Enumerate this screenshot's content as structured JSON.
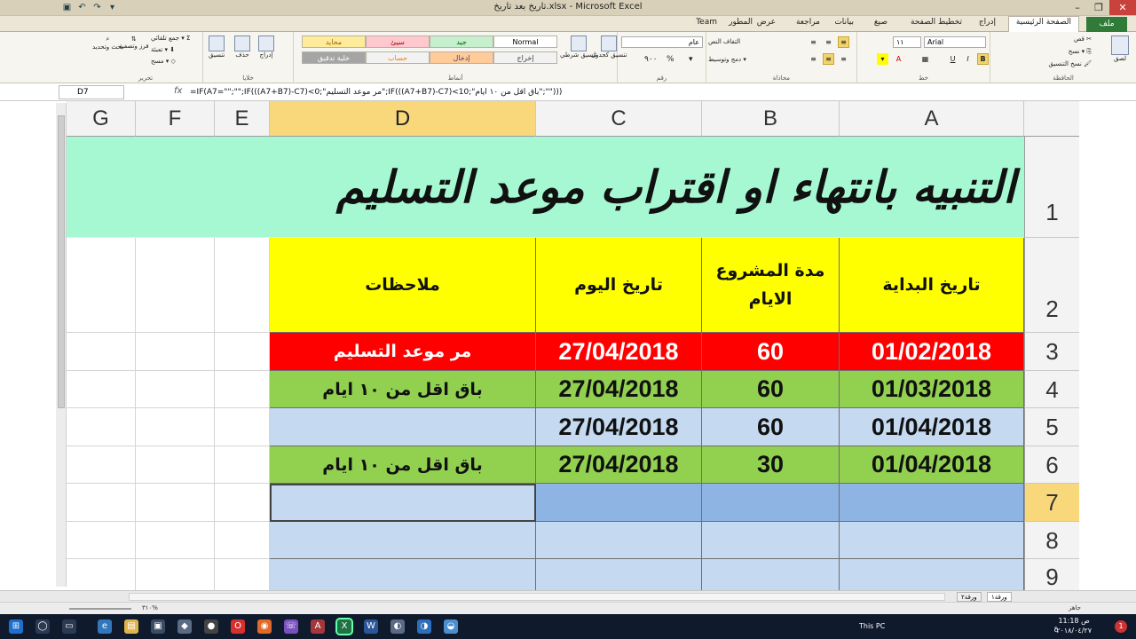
{
  "window": {
    "title": "تاريخ بعد تاريخ.xlsx - Microsoft Excel",
    "minimize": "–",
    "restore": "❐",
    "close": "✕"
  },
  "qat": [
    "▣",
    "↶",
    "↷",
    "▾"
  ],
  "ribbon_tabs": [
    "ملف",
    "الصفحة الرئيسية",
    "إدراج",
    "تخطيط الصفحة",
    "صيغ",
    "بيانات",
    "مراجعة",
    "عرض",
    "المطور",
    "Team"
  ],
  "ribbon": {
    "clipboard": {
      "paste": "لصق",
      "cut": "قص",
      "copy": "نسخ ▾",
      "format_painter": "نسخ التنسيق",
      "label": "الحافظة"
    },
    "font": {
      "name": "Arial",
      "size": "١١",
      "bold": "B",
      "italic": "I",
      "underline": "U",
      "label": "خط"
    },
    "alignment": {
      "wrap": "التفاف النص",
      "merge": "دمج وتوسيط ▾",
      "label": "محاذاة"
    },
    "number": {
      "format": "عام",
      "percent": "%",
      "comma": "٩٠٠",
      "currency": "▾",
      "label": "رقم"
    },
    "styles": {
      "conditional": "تنسيق شرطي",
      "as_table": "تنسيق كجدول",
      "cells": [
        {
          "text": "Normal",
          "bg": "#ffffff",
          "fg": "#000000"
        },
        {
          "text": "جيد",
          "bg": "#c6efce",
          "fg": "#006100"
        },
        {
          "text": "سيئ",
          "bg": "#ffc7ce",
          "fg": "#9c0006"
        },
        {
          "text": "محايد",
          "bg": "#ffeb9c",
          "fg": "#9c6500"
        },
        {
          "text": "إخراج",
          "bg": "#f2f2f2",
          "fg": "#3f3f3f"
        },
        {
          "text": "إدخال",
          "bg": "#ffcc99",
          "fg": "#3f3f76"
        },
        {
          "text": "حساب",
          "bg": "#f2f2f2",
          "fg": "#fa7d00"
        },
        {
          "text": "خلية تدقيق",
          "bg": "#a5a5a5",
          "fg": "#ffffff"
        }
      ],
      "label": "أنماط"
    },
    "cells_group": {
      "insert": "إدراج",
      "delete": "حذف",
      "format": "تنسيق",
      "label": "خلايا"
    },
    "editing": {
      "autosum": "جمع تلقائي ▾",
      "fill": "تعبئة ▾",
      "clear": "مسح ▾",
      "sort": "فرز وتصفية",
      "find": "بحث وتحديد",
      "label": "تحرير"
    }
  },
  "formula_bar": {
    "name_box": "D7",
    "fx": "fx",
    "formula": "=IF(A7=\"\";\"\";IF(((A7+B7)-C7)<0;\"مر موعد التسليم\";IF(((A7+B7)-C7)<10;\"باق اقل من ١٠ ايام\";\"\")))"
  },
  "columns": [
    "G",
    "F",
    "E",
    "D",
    "C",
    "B",
    "A"
  ],
  "selected_column": "D",
  "rows": [
    "1",
    "2",
    "3",
    "4",
    "5",
    "6",
    "7",
    "8",
    "9"
  ],
  "selected_row": "7",
  "sheet": {
    "title": "التنبيه بانتهاء او اقتراب موعد التسليم",
    "headers": {
      "A": "تاريخ البداية",
      "B": "مدة المشروع الايام",
      "C": "تاريخ اليوم",
      "D": "ملاحظات"
    },
    "data": [
      {
        "A": "01/02/2018",
        "B": "60",
        "C": "27/04/2018",
        "D": "مر موعد التسليم",
        "bg": "#ff0000",
        "dbg": "#ff0000",
        "fg": "#ffffff"
      },
      {
        "A": "01/03/2018",
        "B": "60",
        "C": "27/04/2018",
        "D": "باق اقل من ١٠ ايام",
        "bg": "#92d050",
        "dbg": "#92d050",
        "fg": "#111111"
      },
      {
        "A": "01/04/2018",
        "B": "60",
        "C": "27/04/2018",
        "D": "",
        "bg": "#c5d9f1",
        "dbg": "#c5d9f1",
        "fg": "#111111"
      },
      {
        "A": "01/04/2018",
        "B": "30",
        "C": "27/04/2018",
        "D": "باق اقل من ١٠ ايام",
        "bg": "#92d050",
        "dbg": "#92d050",
        "fg": "#111111"
      },
      {
        "A": "",
        "B": "",
        "C": "",
        "D": "",
        "bg": "#8db4e2",
        "dbg": "#c5d9f1",
        "fg": "#111111"
      },
      {
        "A": "",
        "B": "",
        "C": "",
        "D": "",
        "bg": "#c5d9f1",
        "dbg": "#c5d9f1",
        "fg": "#111111"
      },
      {
        "A": "",
        "B": "",
        "C": "",
        "D": "",
        "bg": "#c5d9f1",
        "dbg": "#c5d9f1",
        "fg": "#111111"
      }
    ],
    "title_bg": "#a6f8d2",
    "header_bg": "#ffff00"
  },
  "sheet_tabs": [
    "ورقة١",
    "ورقة٢"
  ],
  "status": {
    "ready": "جاهز",
    "zoom": "٣١٠%"
  },
  "taskbar": {
    "this_pc": "This PC",
    "time": "11:18 ص",
    "date": "٢٠١٨/٠٤/٢٧",
    "lang": "ع",
    "badge": "1"
  }
}
